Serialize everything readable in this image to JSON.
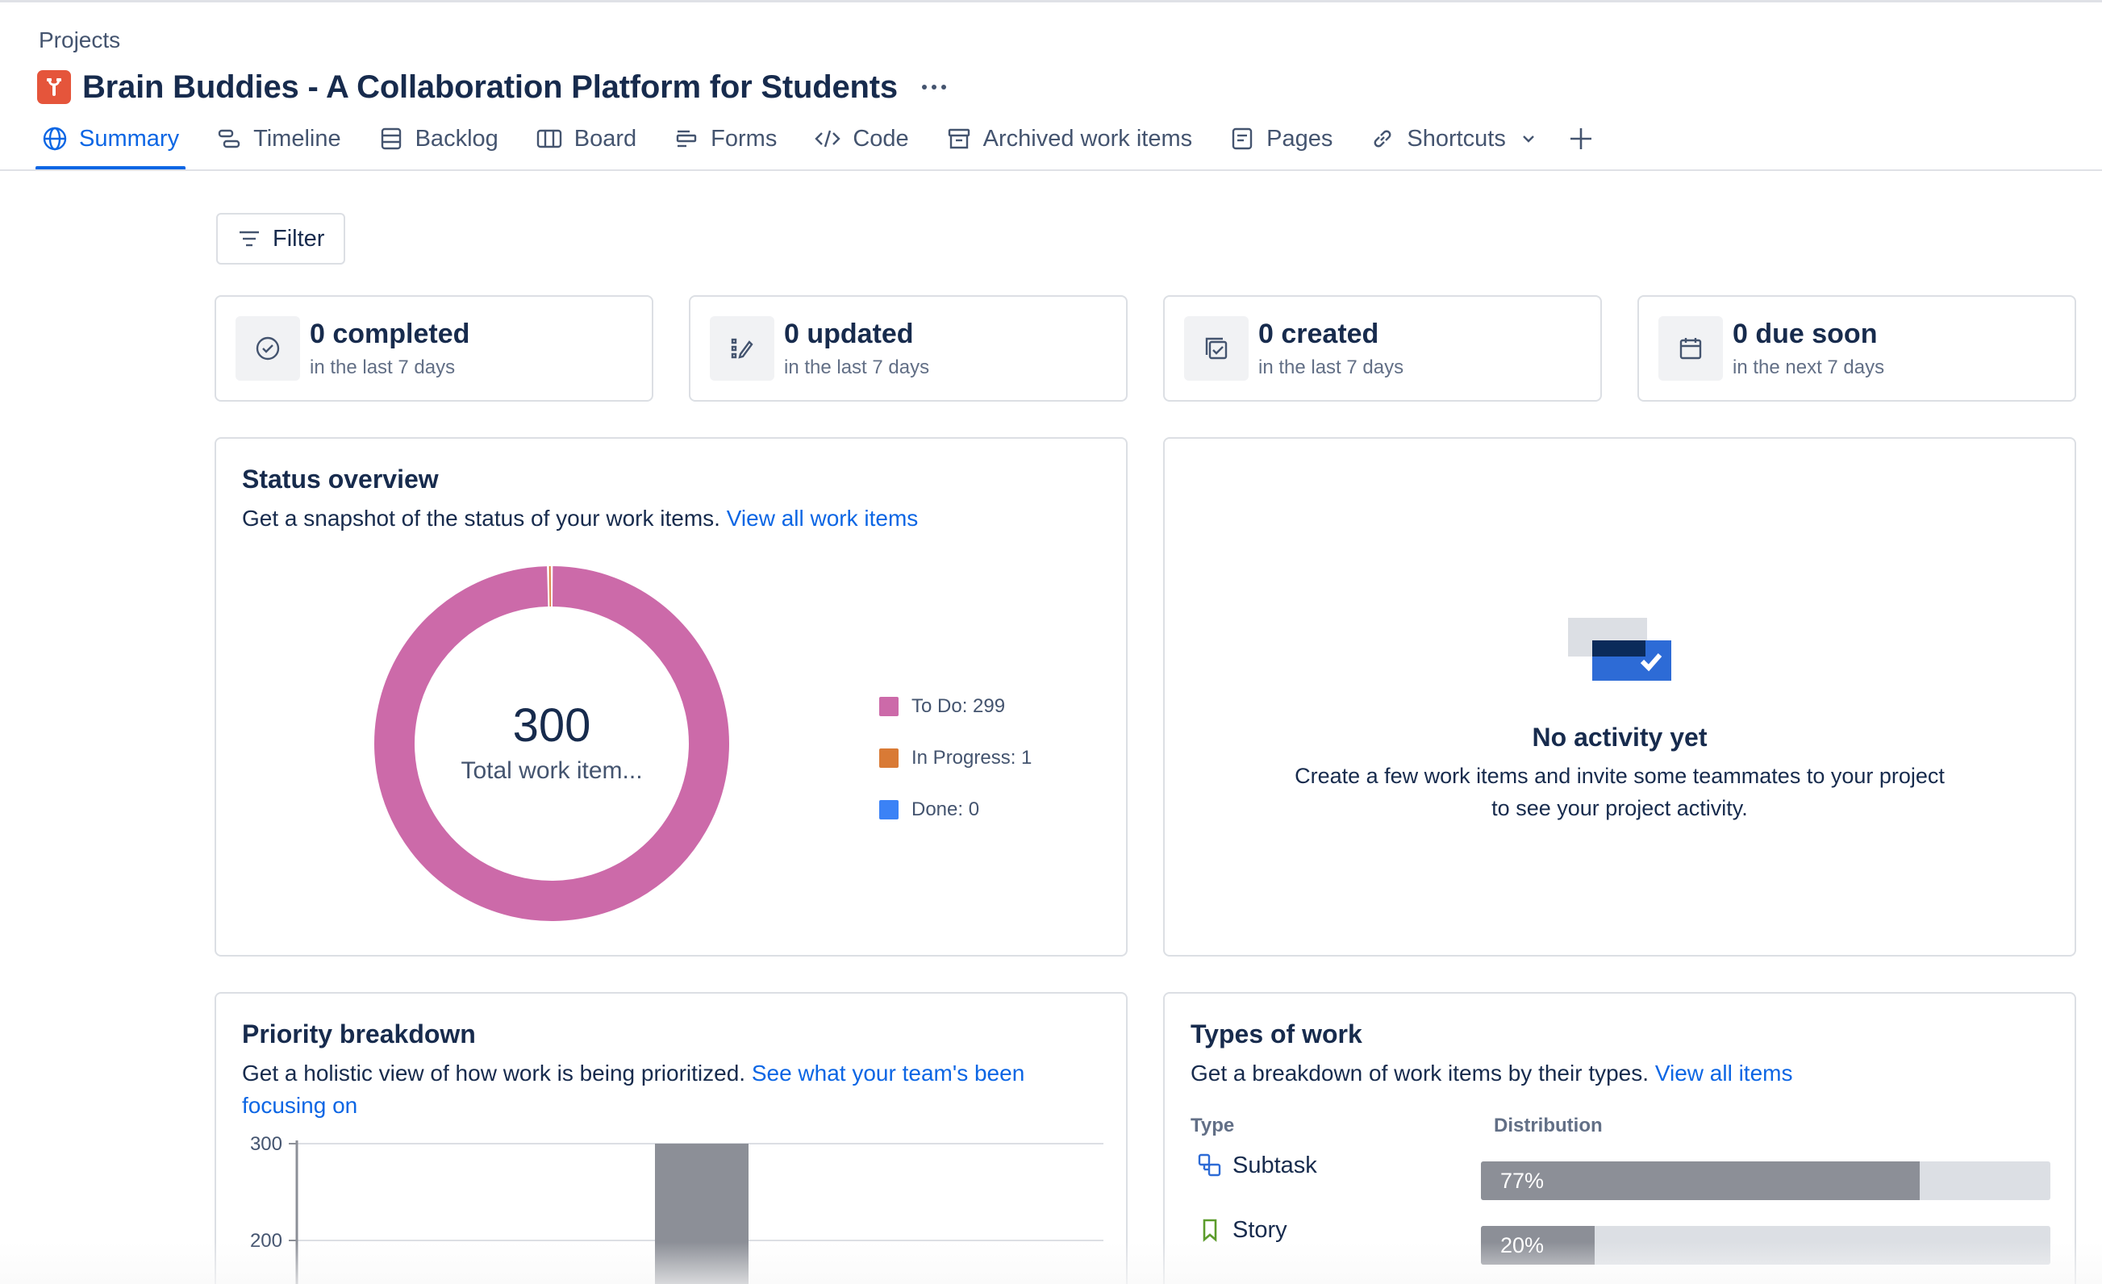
{
  "breadcrumb": "Projects",
  "project": {
    "title": "Brain Buddies - A Collaboration Platform for Students",
    "icon": "project-avatar-icon"
  },
  "tabs": [
    {
      "label": "Summary",
      "icon": "globe-icon",
      "active": true
    },
    {
      "label": "Timeline",
      "icon": "timeline-icon"
    },
    {
      "label": "Backlog",
      "icon": "backlog-icon"
    },
    {
      "label": "Board",
      "icon": "board-icon"
    },
    {
      "label": "Forms",
      "icon": "forms-icon"
    },
    {
      "label": "Code",
      "icon": "code-icon"
    },
    {
      "label": "Archived work items",
      "icon": "archive-icon"
    },
    {
      "label": "Pages",
      "icon": "pages-icon"
    },
    {
      "label": "Shortcuts",
      "icon": "link-icon"
    }
  ],
  "filter_label": "Filter",
  "stats": [
    {
      "title": "0 completed",
      "subtitle": "in the last 7 days",
      "icon": "check-circle-icon"
    },
    {
      "title": "0 updated",
      "subtitle": "in the last 7 days",
      "icon": "edit-icon"
    },
    {
      "title": "0 created",
      "subtitle": "in the last 7 days",
      "icon": "create-icon"
    },
    {
      "title": "0 due soon",
      "subtitle": "in the next 7 days",
      "icon": "calendar-icon"
    }
  ],
  "status_overview": {
    "title": "Status overview",
    "description": "Get a snapshot of the status of your work items.",
    "link": "View all work items",
    "total": "300",
    "total_label": "Total work item...",
    "legend": [
      "To Do: 299",
      "In Progress: 1",
      "Done: 0"
    ]
  },
  "activity": {
    "title": "No activity yet",
    "description": "Create a few work items and invite some teammates to your project to see your project activity."
  },
  "priority": {
    "title": "Priority breakdown",
    "description": "Get a holistic view of how work is being prioritized.",
    "link": "See what your team's been focusing on",
    "y_ticks": [
      "300",
      "200"
    ]
  },
  "types": {
    "title": "Types of work",
    "description": "Get a breakdown of work items by their types.",
    "link": "View all items",
    "col_type": "Type",
    "col_distribution": "Distribution",
    "rows": [
      {
        "label": "Subtask",
        "percent": "77%",
        "icon": "subtask-icon"
      },
      {
        "label": "Story",
        "percent": "20%",
        "icon": "story-bookmark-icon"
      }
    ]
  },
  "colors": {
    "todo": "#cc6aa9",
    "in_progress": "#d97a35",
    "done": "#3b82f6",
    "accent": "#0c66e4",
    "bar": "#8c8f97"
  },
  "chart_data": [
    {
      "type": "pie",
      "title": "Status overview",
      "categories": [
        "To Do",
        "In Progress",
        "Done"
      ],
      "values": [
        299,
        1,
        0
      ]
    },
    {
      "type": "bar",
      "title": "Priority breakdown",
      "ylim": [
        0,
        300
      ],
      "y_ticks_visible": [
        300,
        200
      ],
      "visible_bar_value": 300
    },
    {
      "type": "bar",
      "title": "Types of work",
      "categories": [
        "Subtask",
        "Story"
      ],
      "values": [
        77,
        20
      ],
      "unit": "%"
    }
  ]
}
